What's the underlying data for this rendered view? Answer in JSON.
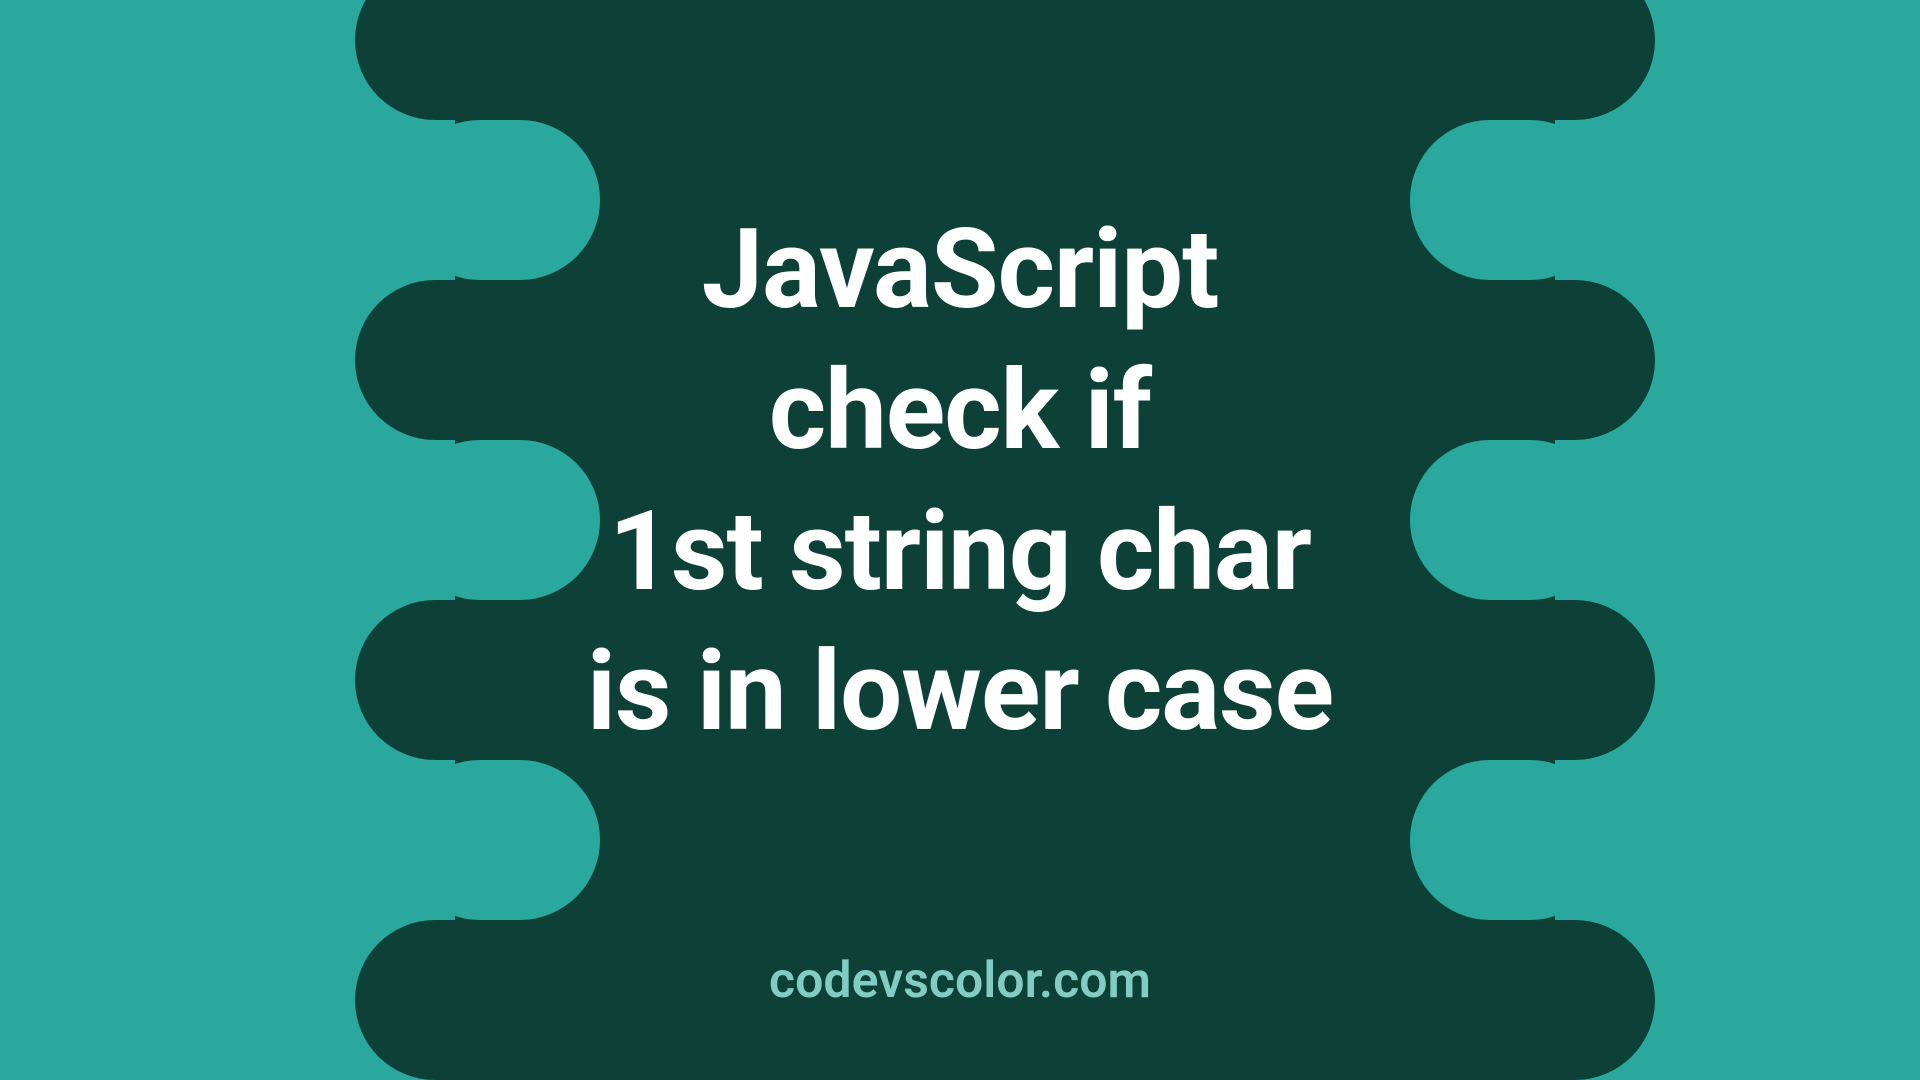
{
  "title_lines": [
    "JavaScript",
    "check if",
    "1st string char",
    "is in lower case"
  ],
  "site": "codevscolor.com",
  "colors": {
    "background_light": "#2aa89e",
    "background_dark": "#0d4138",
    "text_main": "#ffffff",
    "text_site": "#83ccc4"
  }
}
